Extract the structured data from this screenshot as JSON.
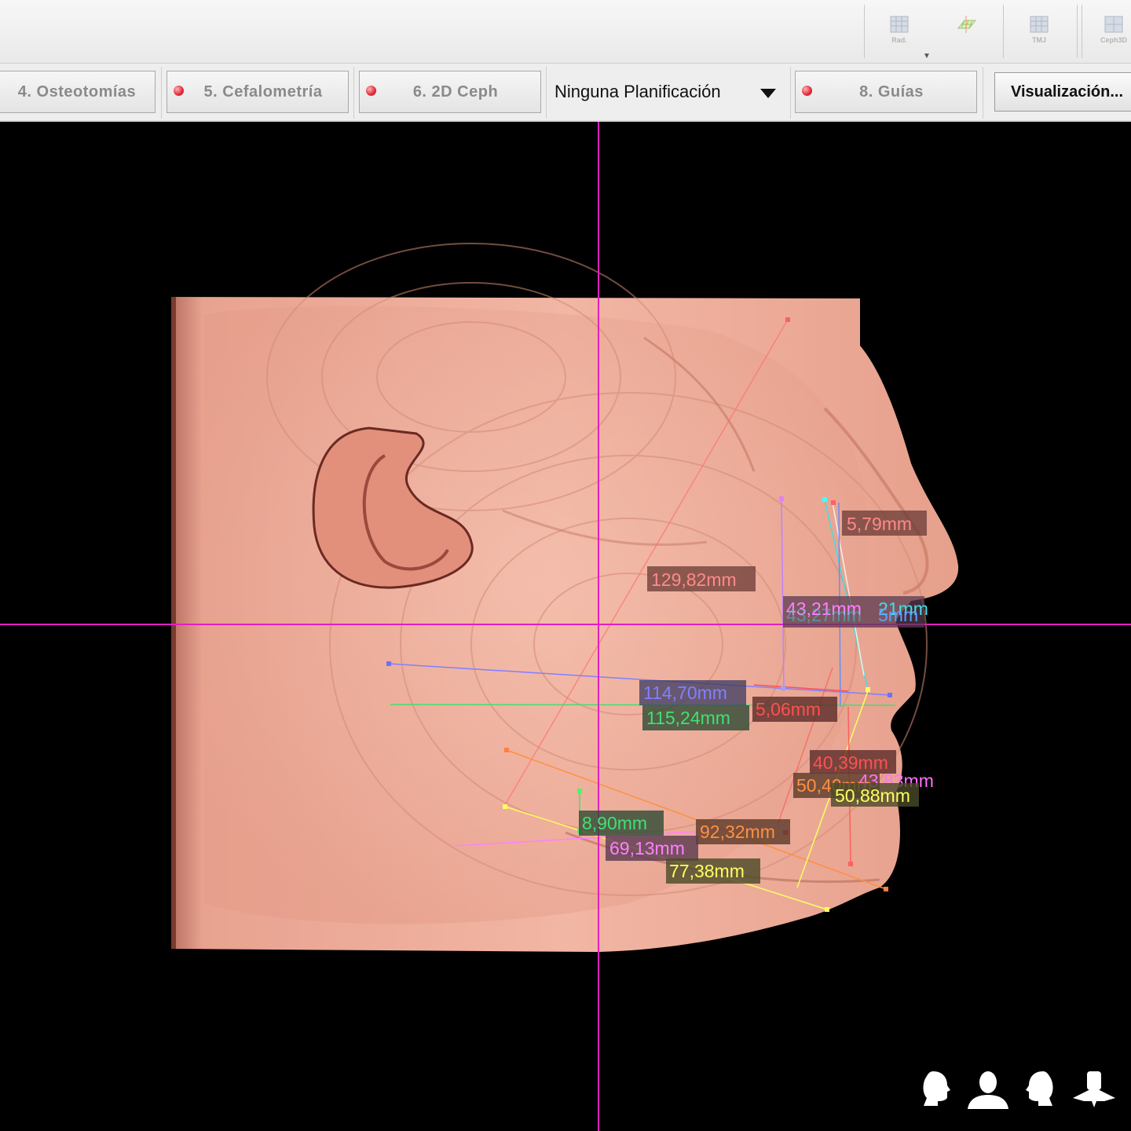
{
  "toolbar": {
    "buttons": [
      {
        "label": "Rad.",
        "icon": "radiograph-icon",
        "dropdown": "▼"
      },
      {
        "label": "",
        "icon": "slice-plane-icon"
      },
      {
        "label": "TMJ",
        "icon": "tmj-icon"
      },
      {
        "label": "Ceph3D",
        "icon": "ceph3d-icon"
      }
    ]
  },
  "tabs": [
    {
      "label": "4. Osteotomías",
      "status": "none"
    },
    {
      "label": "5. Cefalometría",
      "status": "red"
    },
    {
      "label": "6. 2D Ceph",
      "status": "red"
    },
    {
      "label": "8. Guías",
      "status": "red"
    }
  ],
  "planning_select": {
    "value": "Ninguna Planificación"
  },
  "visualization_button": {
    "label": "Visualización..."
  },
  "viewport": {
    "crosshair_color": "#e020c0",
    "measurements": [
      {
        "text": "5,79mm",
        "color": "#ff8a8a"
      },
      {
        "text": "129,82mm",
        "color": "#ff8a8a"
      },
      {
        "text": "43,21mm",
        "color": "#ff80ff"
      },
      {
        "text": "21mm",
        "color": "#40e0e0"
      },
      {
        "text": "43,27mm",
        "color": "#40d0d0"
      },
      {
        "text": "5mm",
        "color": "#60a0ff"
      },
      {
        "text": "114,70mm",
        "color": "#8080ff"
      },
      {
        "text": "115,24mm",
        "color": "#40e070"
      },
      {
        "text": "5,06mm",
        "color": "#ff5050"
      },
      {
        "text": "40,39mm",
        "color": "#ff5050"
      },
      {
        "text": "50,40mm",
        "color": "#ff9040"
      },
      {
        "text": "43,83mm",
        "color": "#ff70ff"
      },
      {
        "text": "50,88mm",
        "color": "#ffff60"
      },
      {
        "text": "8,90mm",
        "color": "#40e070"
      },
      {
        "text": "92,32mm",
        "color": "#ff9040"
      },
      {
        "text": "69,13mm",
        "color": "#ff80ff"
      },
      {
        "text": "77,38mm",
        "color": "#ffff60"
      }
    ],
    "view_presets": [
      {
        "icon": "head-profile-right-icon"
      },
      {
        "icon": "head-frontal-icon"
      },
      {
        "icon": "head-profile-left-icon"
      },
      {
        "icon": "head-top-icon"
      }
    ]
  }
}
